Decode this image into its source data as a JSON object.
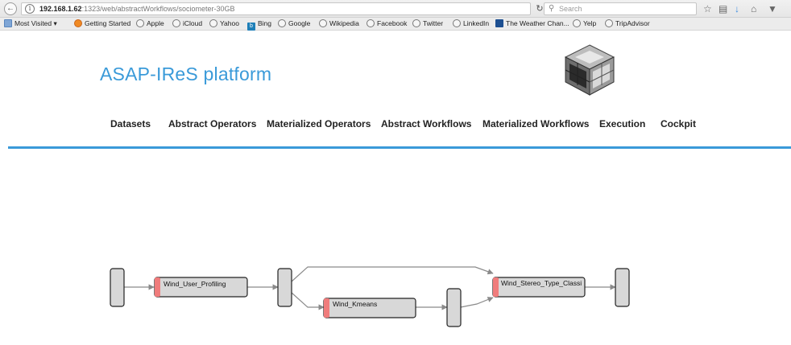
{
  "browser": {
    "url_host": "192.168.1.62",
    "url_path": ":1323/web/abstractWorkflows/sociometer-30GB",
    "search_placeholder": "Search",
    "bookmarks": [
      {
        "label": "Most Visited ▾",
        "icon": "folder-icon"
      },
      {
        "label": "Getting Started",
        "icon": "firefox-icon"
      },
      {
        "label": "Apple",
        "icon": "globe-icon"
      },
      {
        "label": "iCloud",
        "icon": "globe-icon"
      },
      {
        "label": "Yahoo",
        "icon": "globe-icon"
      },
      {
        "label": "Bing",
        "icon": "bing-icon"
      },
      {
        "label": "Google",
        "icon": "globe-icon"
      },
      {
        "label": "Wikipedia",
        "icon": "globe-icon"
      },
      {
        "label": "Facebook",
        "icon": "globe-icon"
      },
      {
        "label": "Twitter",
        "icon": "globe-icon"
      },
      {
        "label": "LinkedIn",
        "icon": "globe-icon"
      },
      {
        "label": "The Weather Chan...",
        "icon": "weather-icon"
      },
      {
        "label": "Yelp",
        "icon": "globe-icon"
      },
      {
        "label": "TripAdvisor",
        "icon": "globe-icon"
      }
    ]
  },
  "site": {
    "title": "ASAP-IReS platform",
    "nav": [
      "Datasets",
      "Abstract Operators",
      "Materialized Operators",
      "Abstract Workflows",
      "Materialized Workflows",
      "Execution",
      "Cockpit"
    ]
  },
  "workflow": {
    "operators": [
      "Wind_User_Profiling",
      "Wind_Kmeans",
      "Wind_Stereo_Type_Classi"
    ]
  },
  "colors": {
    "brand": "#3a9ad9",
    "operator_marker": "#f07c7c",
    "node_fill": "#d8d8d8",
    "edge": "#8a8a8a"
  }
}
